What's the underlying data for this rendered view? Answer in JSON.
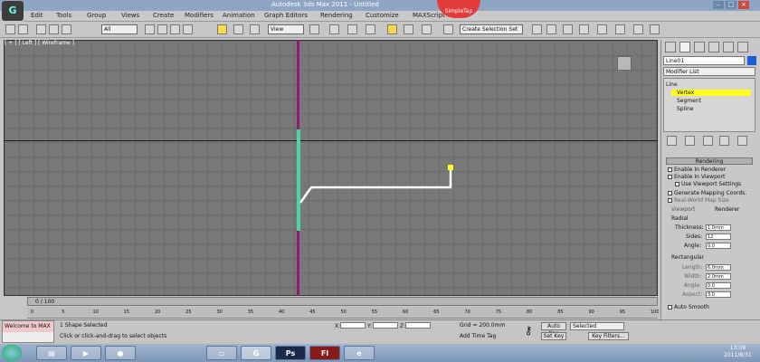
{
  "window": {
    "title": "Autodesk 3ds Max 2011 - Untitled"
  },
  "app_icon": "3ds-max-icon",
  "menu": [
    "Edit",
    "Tools",
    "Group",
    "Views",
    "Create",
    "Modifiers",
    "Animation",
    "Graph Editors",
    "Rendering",
    "Customize",
    "MAXScript"
  ],
  "badge": "SimpleTap",
  "toolbar": {
    "filter": "All",
    "refcoord": "View",
    "named_selection": "Create Selection Set"
  },
  "viewport": {
    "label": "[ + ] [ Left ] [ Wireframe ]"
  },
  "command_panel": {
    "object_name": "Line01",
    "object_color": "#1f5bd8",
    "modifier_list": "Modifier List",
    "stack": [
      {
        "label": "Line",
        "level": 0
      },
      {
        "label": "Vertex",
        "level": 1,
        "selected": true
      },
      {
        "label": "Segment",
        "level": 1
      },
      {
        "label": "Spline",
        "level": 1
      }
    ],
    "rendering": {
      "title": "Rendering",
      "enable_renderer": "Enable In Renderer",
      "enable_viewport": "Enable In Viewport",
      "use_viewport_settings": "Use Viewport Settings",
      "gen_mapping": "Generate Mapping Coords.",
      "real_world": "Real-World Map Size",
      "viewport": "Viewport",
      "renderer": "Renderer",
      "radial": "Radial",
      "thickness_label": "Thickness:",
      "thickness": "1.0mm",
      "sides_label": "Sides:",
      "sides": "12",
      "angle_label": "Angle:",
      "angle": "0.0",
      "rectangular": "Rectangular",
      "length_label": "Length:",
      "length": "6.0mm",
      "width_label": "Width:",
      "width": "2.0mm",
      "angle2": "0.0",
      "aspect_label": "Aspect:",
      "aspect": "3.0",
      "auto_smooth": "Auto Smooth"
    }
  },
  "timeline": {
    "frame": "0 / 100",
    "ticks": [
      "0",
      "5",
      "10",
      "15",
      "20",
      "25",
      "30",
      "35",
      "40",
      "45",
      "50",
      "55",
      "60",
      "65",
      "70",
      "75",
      "80",
      "85",
      "90",
      "95",
      "100"
    ]
  },
  "status": {
    "minilistener": "Welcome to MAX",
    "selection": "1 Shape Selected",
    "prompt": "Click or click-and-drag to select objects",
    "x_label": "X:",
    "y_label": "Y:",
    "z_label": "Z:",
    "grid": "Grid = 200.0mm",
    "add_time_tag": "Add Time Tag",
    "auto_key": "Auto Key",
    "set_key": "Set Key",
    "selected": "Selected",
    "key_filters": "Key Filters..."
  },
  "taskbar": {
    "apps": [
      "explorer",
      "media",
      "firefox",
      "folder",
      "3dsmax",
      "photoshop",
      "flash",
      "ie"
    ],
    "clock_time": "13:09",
    "clock_date": "2011/8/31"
  }
}
